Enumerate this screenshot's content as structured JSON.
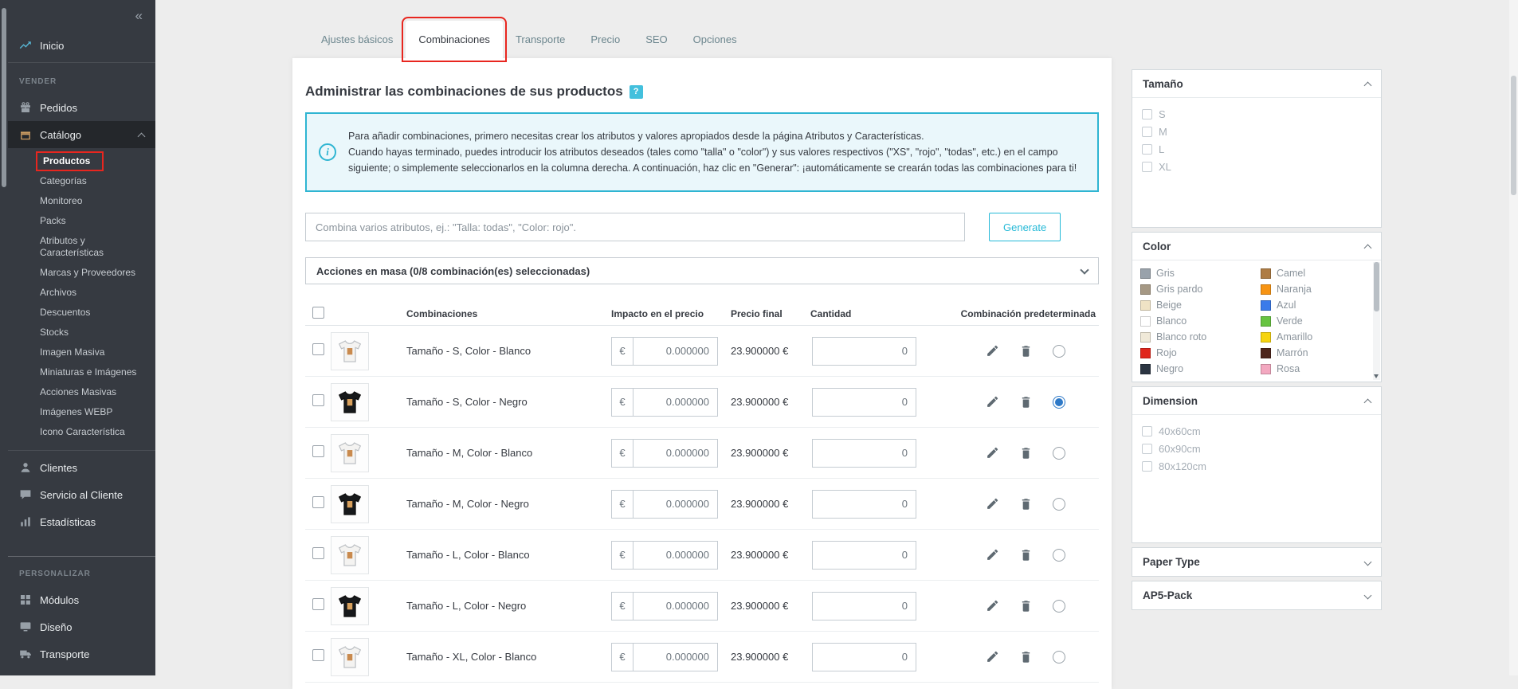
{
  "annotations": {
    "highlight_color": "#e8261f"
  },
  "sidebar": {
    "collapse_icon": "«",
    "home_label": "Inicio",
    "sections": {
      "vender": "VENDER",
      "personalizar": "PERSONALIZAR"
    },
    "pedidos": "Pedidos",
    "catalogo": "Catálogo",
    "catalogo_children": [
      "Productos",
      "Categorías",
      "Monitoreo",
      "Packs",
      "Atributos y Características",
      "Marcas y Proveedores",
      "Archivos",
      "Descuentos",
      "Stocks",
      "Imagen Masiva",
      "Miniaturas e Imágenes",
      "Acciones Masivas",
      "Imágenes WEBP",
      "Icono Característica"
    ],
    "clientes": "Clientes",
    "servicio_cliente": "Servicio al Cliente",
    "estadisticas": "Estadísticas",
    "modulos": "Módulos",
    "diseno": "Diseño",
    "transporte": "Transporte"
  },
  "tabs": {
    "items": [
      "Ajustes básicos",
      "Combinaciones",
      "Transporte",
      "Precio",
      "SEO",
      "Opciones"
    ],
    "active": "Combinaciones"
  },
  "main": {
    "title": "Administrar las combinaciones de sus productos",
    "help_badge": "?",
    "info_icon": "i",
    "info_text": "Para añadir combinaciones, primero necesitas crear los atributos y valores apropiados desde la página Atributos y Características.\nCuando hayas terminado, puedes introducir los atributos deseados (tales como \"talla\" o \"color\") y sus valores respectivos (\"XS\", \"rojo\", \"todas\", etc.) en el campo siguiente; o simplemente seleccionarlos en la columna derecha. A continuación, haz clic en \"Generar\": ¡automáticamente se crearán todas las combinaciones para ti!",
    "attribute_input_placeholder": "Combina varios atributos, ej.: \"Talla: todas\", \"Color: rojo\".",
    "generate_button": "Generate",
    "bulk_actions_label": "Acciones en masa (0/8 combinación(es) seleccionadas)",
    "table": {
      "headers": {
        "combinations": "Combinaciones",
        "impact": "Impacto en el precio",
        "final_price": "Precio final",
        "quantity": "Cantidad",
        "default": "Combinación predeterminada"
      },
      "currency": "€",
      "rows": [
        {
          "label": "Tamaño - S, Color - Blanco",
          "image": "white-shirt",
          "impact": "0.000000",
          "final_price": "23.900000 €",
          "quantity": "0",
          "is_default": false
        },
        {
          "label": "Tamaño - S, Color - Negro",
          "image": "black-shirt",
          "impact": "0.000000",
          "final_price": "23.900000 €",
          "quantity": "0",
          "is_default": true
        },
        {
          "label": "Tamaño - M, Color - Blanco",
          "image": "white-shirt",
          "impact": "0.000000",
          "final_price": "23.900000 €",
          "quantity": "0",
          "is_default": false
        },
        {
          "label": "Tamaño - M, Color - Negro",
          "image": "black-shirt",
          "impact": "0.000000",
          "final_price": "23.900000 €",
          "quantity": "0",
          "is_default": false
        },
        {
          "label": "Tamaño - L, Color - Blanco",
          "image": "white-shirt",
          "impact": "0.000000",
          "final_price": "23.900000 €",
          "quantity": "0",
          "is_default": false
        },
        {
          "label": "Tamaño - L, Color - Negro",
          "image": "black-shirt",
          "impact": "0.000000",
          "final_price": "23.900000 €",
          "quantity": "0",
          "is_default": false
        },
        {
          "label": "Tamaño - XL, Color - Blanco",
          "image": "white-shirt",
          "impact": "0.000000",
          "final_price": "23.900000 €",
          "quantity": "0",
          "is_default": false
        }
      ]
    }
  },
  "attributes_panel": {
    "groups": [
      {
        "name": "Tamaño",
        "expanded": true,
        "items": [
          "S",
          "M",
          "L",
          "XL"
        ]
      },
      {
        "name": "Color",
        "expanded": true,
        "items": [
          {
            "label": "Gris",
            "color": "#99a2ab"
          },
          {
            "label": "Gris pardo",
            "color": "#a59884"
          },
          {
            "label": "Beige",
            "color": "#efe3c5"
          },
          {
            "label": "Blanco",
            "color": "#ffffff"
          },
          {
            "label": "Blanco roto",
            "color": "#f0e9d8"
          },
          {
            "label": "Rojo",
            "color": "#e0251b"
          },
          {
            "label": "Negro",
            "color": "#2b3542"
          },
          {
            "label": "Camel",
            "color": "#ae7c44"
          },
          {
            "label": "Naranja",
            "color": "#f79413"
          },
          {
            "label": "Azul",
            "color": "#3a7bea"
          },
          {
            "label": "Verde",
            "color": "#67c441"
          },
          {
            "label": "Amarillo",
            "color": "#f6d410"
          },
          {
            "label": "Marrón",
            "color": "#4d251b"
          },
          {
            "label": "Rosa",
            "color": "#f3a8c0"
          }
        ]
      },
      {
        "name": "Dimension",
        "expanded": true,
        "items": [
          "40x60cm",
          "60x90cm",
          "80x120cm"
        ]
      },
      {
        "name": "Paper Type",
        "expanded": false,
        "items": []
      },
      {
        "name": "AP5-Pack",
        "expanded": false,
        "items": []
      }
    ]
  }
}
